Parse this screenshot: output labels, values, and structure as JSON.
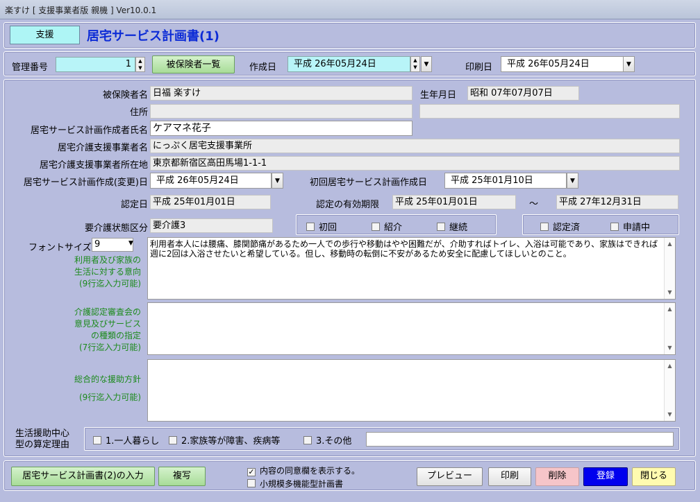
{
  "window": {
    "title": "楽すけ [ 支援事業者版 親機 ] Ver10.0.1"
  },
  "header": {
    "mode_button": "支援",
    "form_title": "居宅サービス計画書(1)"
  },
  "toolbar": {
    "mgmt_no_label": "管理番号",
    "mgmt_no_value": "1",
    "insured_list_button": "被保険者一覧",
    "created_label": "作成日",
    "created_value": "平成 26年05月24日",
    "print_date_label": "印刷日",
    "print_date_value": "平成 26年05月24日"
  },
  "form": {
    "insured_name_label": "被保険者名",
    "insured_name": "日福 楽すけ",
    "birthdate_label": "生年月日",
    "birthdate": "昭和 07年07月07日",
    "address_label": "住所",
    "address": "",
    "address2": "",
    "planner_label": "居宅サービス計画作成者氏名",
    "planner": "ケアマネ花子",
    "office_label": "居宅介護支援事業者名",
    "office": "にっぷく居宅支援事業所",
    "office_addr_label": "居宅介護支援事業者所在地",
    "office_addr": "東京都新宿区高田馬場1-1-1",
    "plan_date_label": "居宅サービス計画作成(変更)日",
    "plan_date": "平成 26年05月24日",
    "first_plan_label": "初回居宅サービス計画作成日",
    "first_plan": "平成 25年01月10日",
    "cert_date_label": "認定日",
    "cert_date": "平成 25年01月01日",
    "valid_label": "認定の有効期限",
    "valid_from": "平成 25年01月01日",
    "tilde": "〜",
    "valid_to": "平成 27年12月31日",
    "care_level_label": "要介護状態区分",
    "care_level": "要介護3",
    "cb_first": "初回",
    "cb_referral": "紹介",
    "cb_continue": "継続",
    "cb_certified": "認定済",
    "cb_applying": "申請中",
    "font_size_label": "フォントサイズ",
    "font_size": "9",
    "intent_label": [
      "利用者及び家族の",
      "生活に対する意向",
      "(9行迄入力可能)"
    ],
    "intent_text": "利用者本人には腰痛、膝関節痛があるため一人での歩行や移動はやや困難だが、介助すればトイレ、入浴は可能であり、家族はできれば週に2回は入浴させたいと希望している。但し、移動時の転倒に不安があるため安全に配慮してほしいとのこと。",
    "opinion_label": [
      "介護認定審査会の",
      "意見及びサービス",
      "の種類の指定",
      "(7行迄入力可能)"
    ],
    "opinion_text": "",
    "policy_label": [
      "総合的な援助方針",
      "",
      "(9行迄入力可能)"
    ],
    "policy_text": "",
    "reason_label": [
      "生活援助中心",
      "型の算定理由"
    ],
    "reason1": "1.一人暮らし",
    "reason2": "2.家族等が障害、疾病等",
    "reason3": "3.その他",
    "reason_other": ""
  },
  "footer": {
    "input2_button": "居宅サービス計画書(2)の入力",
    "copy_button": "複写",
    "consent_check": "内容の同意欄を表示する。",
    "small_multi_check": "小規模多機能型計画書",
    "preview_button": "プレビュー",
    "print_button": "印刷",
    "delete_button": "削除",
    "register_button": "登録",
    "close_button": "閉じる"
  },
  "colors": {
    "bg": "#b7bcde",
    "title": "#0c2bd6",
    "green_label": "#1c8a1c",
    "register": "#0000ee",
    "delete": "#f6c5c9",
    "close": "#fffbb0"
  }
}
